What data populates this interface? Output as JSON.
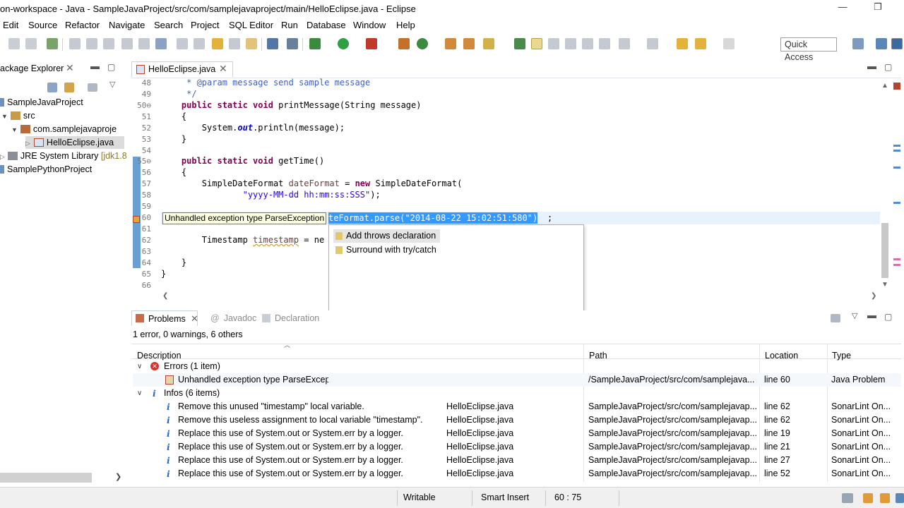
{
  "window": {
    "title": "on-workspace - Java - SampleJavaProject/src/com/samplejavaproject/main/HelloEclipse.java - Eclipse",
    "minimize": "—",
    "restore": "❐"
  },
  "menu": [
    "Edit",
    "Source",
    "Refactor",
    "Navigate",
    "Search",
    "Project",
    "SQL Editor",
    "Run",
    "Database",
    "Window",
    "Help"
  ],
  "toolbar": {
    "quick_access": "Quick Access"
  },
  "package_explorer": {
    "title": "ackage Explorer",
    "items": [
      {
        "label": "SampleJavaProject"
      },
      {
        "label": "src"
      },
      {
        "label": "com.samplejavaproje"
      },
      {
        "label": "HelloEclipse.java"
      },
      {
        "label": "JRE System Library",
        "suffix": "[jdk1.8"
      },
      {
        "label": "SamplePythonProject"
      }
    ]
  },
  "editor": {
    "tab": "HelloEclipse.java",
    "line_numbers": [
      "48",
      "49",
      "50⊖",
      "51",
      "52",
      "53",
      "54",
      "55⊖",
      "56",
      "57",
      "58",
      "59",
      "60",
      "61",
      "62",
      "63",
      "64",
      "65",
      "66"
    ],
    "tooltip": "Unhandled exception type ParseException",
    "selection_text": "teFormat.parse(\"2014-08-22 15:02:51:580\")",
    "line60_end": ";",
    "line62_start": "Timestamp ",
    "line62_var": "timestamp",
    "line62_rest": " = ne",
    "quickfix": [
      {
        "label": "Add throws declaration"
      },
      {
        "label": "Surround with try/catch"
      }
    ]
  },
  "problems": {
    "tabs": [
      "Problems",
      "Javadoc",
      "Declaration"
    ],
    "summary": "1 error, 0 warnings, 6 others",
    "columns": {
      "description": "Description",
      "path": "Path",
      "location": "Location",
      "type": "Type"
    },
    "errors_group": "Errors (1 item)",
    "error_row": {
      "description": "Unhandled exception type ParseExcept",
      "path": "/SampleJavaProject/src/com/samplejava...",
      "location": "line 60",
      "type": "Java Problem"
    },
    "infos_group": "Infos (6 items)",
    "info_rows": [
      {
        "description": "Remove this unused \"timestamp\" local variable.",
        "resource": "HelloEclipse.java",
        "path": "SampleJavaProject/src/com/samplejavap...",
        "location": "line 62",
        "type": "SonarLint On..."
      },
      {
        "description": "Remove this useless assignment to local variable \"timestamp\".",
        "resource": "HelloEclipse.java",
        "path": "SampleJavaProject/src/com/samplejavap...",
        "location": "line 62",
        "type": "SonarLint On..."
      },
      {
        "description": "Replace this use of System.out or System.err by a logger.",
        "resource": "HelloEclipse.java",
        "path": "SampleJavaProject/src/com/samplejavap...",
        "location": "line 19",
        "type": "SonarLint On..."
      },
      {
        "description": "Replace this use of System.out or System.err by a logger.",
        "resource": "HelloEclipse.java",
        "path": "SampleJavaProject/src/com/samplejavap...",
        "location": "line 21",
        "type": "SonarLint On..."
      },
      {
        "description": "Replace this use of System.out or System.err by a logger.",
        "resource": "HelloEclipse.java",
        "path": "SampleJavaProject/src/com/samplejavap...",
        "location": "line 27",
        "type": "SonarLint On..."
      },
      {
        "description": "Replace this use of System.out or System.err by a logger.",
        "resource": "HelloEclipse.java",
        "path": "SampleJavaProject/src/com/samplejavap...",
        "location": "line 52",
        "type": "SonarLint On..."
      }
    ]
  },
  "status": {
    "writable": "Writable",
    "insert_mode": "Smart Insert",
    "position": "60 : 75"
  },
  "colors": {
    "selection": "#3399ff",
    "tooltip_bg": "#ffffe1",
    "keyword": "#7f0055",
    "string": "#2a00ff",
    "comment": "#3f5fbf",
    "info_icon": "#2a68c8",
    "error_icon": "#d9312b"
  }
}
